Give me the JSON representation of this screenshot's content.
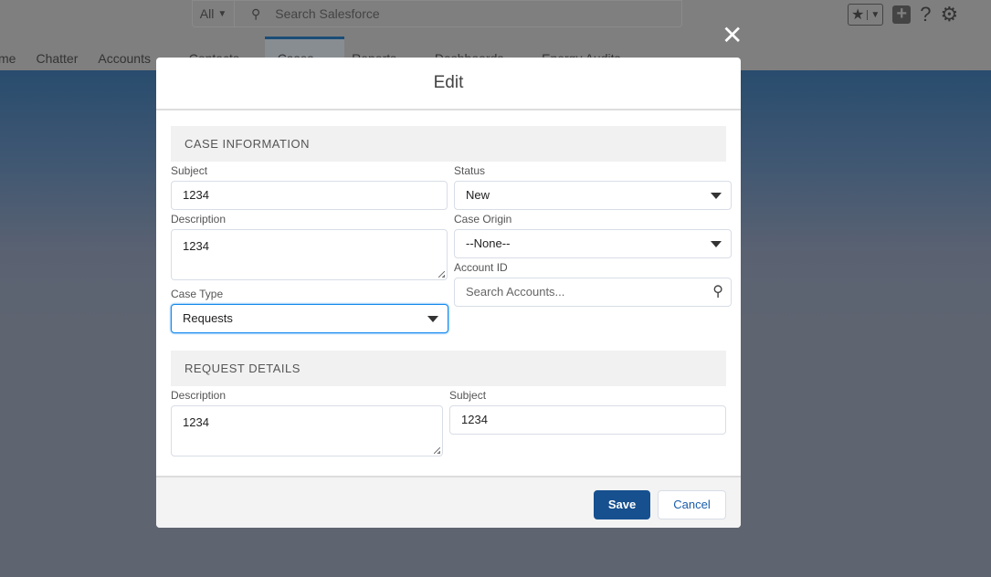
{
  "global_header": {
    "search_scope": "All",
    "search_placeholder": "Search Salesforce"
  },
  "nav": {
    "items": [
      "me",
      "Chatter",
      "Accounts",
      "Contacts",
      "Cases",
      "Reports",
      "Dashboards",
      "Energy Audits"
    ],
    "active": "Cases"
  },
  "modal": {
    "title": "Edit",
    "sections": [
      {
        "title": "CASE INFORMATION"
      },
      {
        "title": "REQUEST DETAILS"
      }
    ],
    "case_info": {
      "subject_label": "Subject",
      "subject_value": "1234",
      "status_label": "Status",
      "status_value": "New",
      "description_label": "Description",
      "description_value": "1234",
      "case_origin_label": "Case Origin",
      "case_origin_value": "--None--",
      "account_id_label": "Account ID",
      "account_id_placeholder": "Search Accounts...",
      "case_type_label": "Case Type",
      "case_type_value": "Requests"
    },
    "request_details": {
      "description_label": "Description",
      "description_value": "1234",
      "subject_label": "Subject",
      "subject_value": "1234"
    },
    "save_label": "Save",
    "cancel_label": "Cancel"
  },
  "accent_color": "#16508f"
}
